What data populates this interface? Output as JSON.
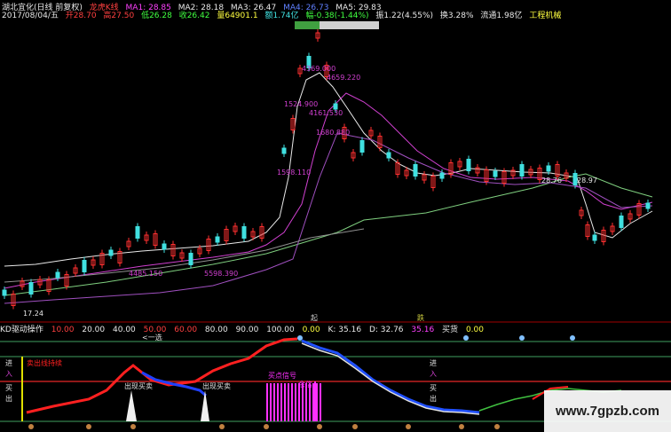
{
  "header": {
    "stock_title": "湖北宜化(日线 前复权)",
    "pick_label": "龙虎K线",
    "ma": [
      {
        "label": "MA1: 28.85",
        "color": "#ff40ff"
      },
      {
        "label": "MA2: 28.18",
        "color": "#e8e8e8"
      },
      {
        "label": "MA3: 26.47",
        "color": "#e8e8e8"
      },
      {
        "label": "MA4: 26.73",
        "color": "#6080ff"
      },
      {
        "label": "MA5: 29.83",
        "color": "#e8e8e8"
      }
    ]
  },
  "quote": {
    "date": "2017/08/04/五",
    "open": "开28.70",
    "high": "高27.50",
    "low": "低26.28",
    "close": "收26.42",
    "volume": "量64901.1",
    "amount": "额1.74亿",
    "change": "幅-0.38(-1.44%)",
    "amplitude": "振1.22(4.55%)",
    "turnover": "换3.28%",
    "float_mv": "流通1.98亿",
    "sector": "工程机械"
  },
  "main_chart": {
    "price_labels": [
      "4369.000",
      "4659.220",
      "1524.900",
      "4161.530",
      "1680.880",
      "1598.110",
      "4485.150",
      "5598.390",
      "17.24",
      "28.76",
      "28.97"
    ],
    "markers": [
      "起",
      "跌"
    ]
  },
  "indicator": {
    "name": "KD驱动操作",
    "scale_values": [
      "10.00",
      "20.00",
      "40.00",
      "50.00",
      "60.00",
      "80.00",
      "90.00",
      "100.00"
    ],
    "status_value": "0.00",
    "k_label": "K: 35.16",
    "d_label": "D: 32.76",
    "j_label": "35.16",
    "buy_label": "买货",
    "buy_value": "0.00",
    "labels_left": [
      "进",
      "入",
      "买",
      "出"
    ],
    "labels_right": [
      "进",
      "入",
      "买",
      "出"
    ],
    "signals": [
      "卖出线持续",
      "出现买卖",
      "出现买卖",
      "买点信号",
      "余信"
    ],
    "top_left_label": "<一选"
  },
  "watermark": "www.7gpzb.com"
}
